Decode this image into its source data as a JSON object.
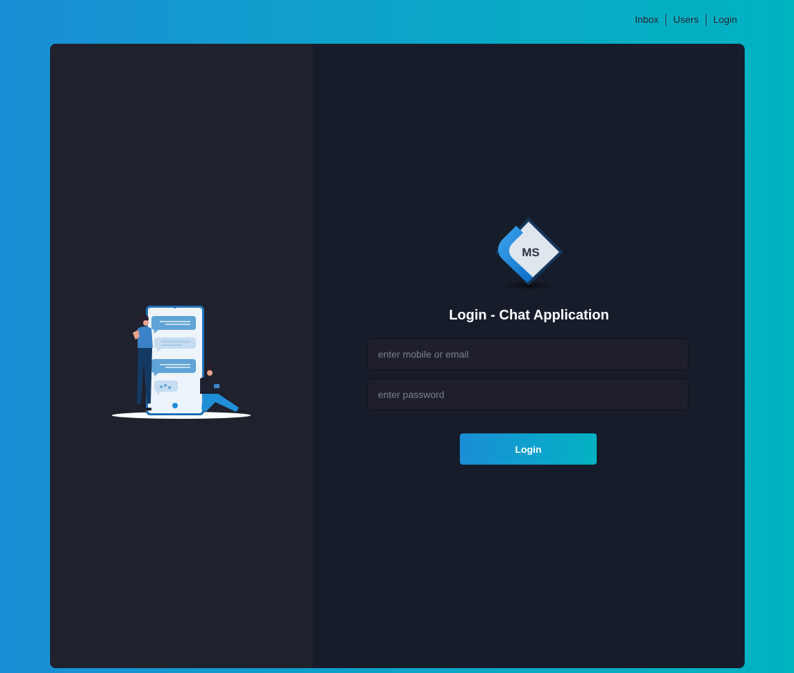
{
  "nav": {
    "items": [
      {
        "label": "Inbox"
      },
      {
        "label": "Users"
      },
      {
        "label": "Login"
      }
    ]
  },
  "logo": {
    "text": "MS"
  },
  "login": {
    "title": "Login - Chat Application",
    "email_placeholder": "enter mobile or email",
    "email_value": "",
    "password_placeholder": "enter password",
    "password_value": "",
    "button_label": "Login"
  },
  "colors": {
    "accent_start": "#1a8ed6",
    "accent_end": "#03b2c3",
    "card_left": "#1f212d",
    "card_right": "#171c2a"
  },
  "icons": {
    "logo": "ms-logo-icon",
    "illustration": "chat-illustration-icon"
  }
}
